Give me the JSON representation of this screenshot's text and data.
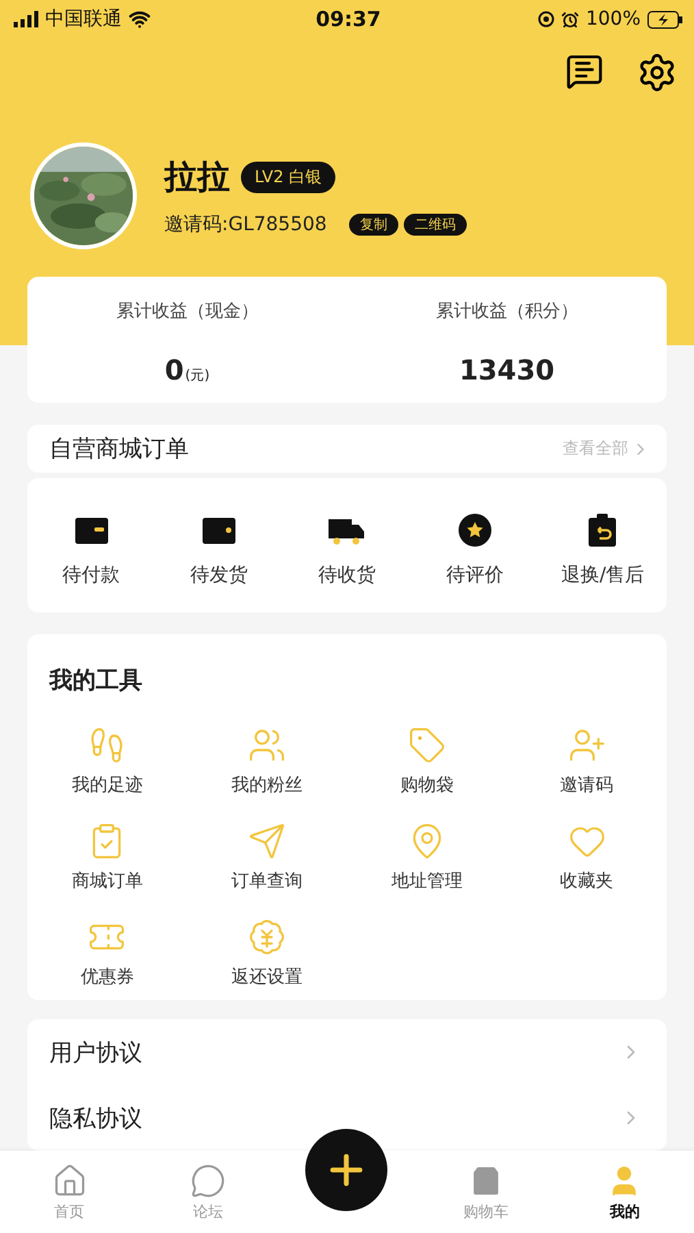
{
  "status_bar": {
    "carrier": "中国联通",
    "time": "09:37",
    "battery": "100%"
  },
  "profile": {
    "name": "拉拉",
    "level_badge": "LV2 白银",
    "invite_code": "邀请码:GL785508",
    "actions": [
      "复制",
      "二维码"
    ]
  },
  "earnings": [
    {
      "label": "累计收益（现金）",
      "value": "0",
      "unit": "(元)"
    },
    {
      "label": "累计收益（积分）",
      "value": "13430"
    }
  ],
  "orders": {
    "title": "自营商城订单",
    "view_all": "查看全部",
    "items": [
      "待付款",
      "待发货",
      "待收货",
      "待评价",
      "退换/售后"
    ]
  },
  "tools": {
    "title": "我的工具",
    "items": [
      "我的足迹",
      "我的粉丝",
      "购物袋",
      "邀请码",
      "商城订单",
      "订单查询",
      "地址管理",
      "收藏夹",
      "优惠券",
      "返还设置"
    ]
  },
  "links": [
    "用户协议",
    "隐私协议"
  ],
  "tab_bar": [
    {
      "label": "首页",
      "selected": false
    },
    {
      "label": "论坛",
      "selected": false
    },
    {
      "label": "购物车",
      "selected": false
    },
    {
      "label": "我的",
      "selected": true
    }
  ]
}
